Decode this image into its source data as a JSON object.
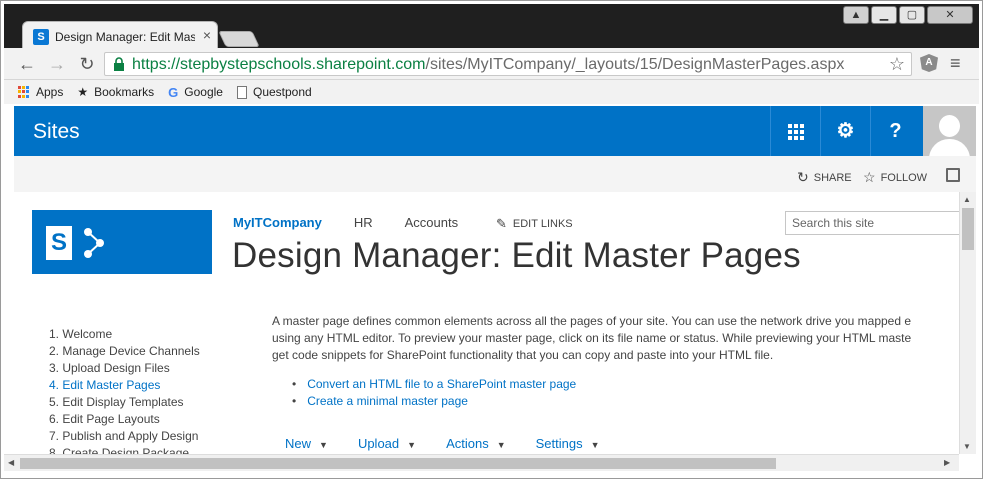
{
  "browser": {
    "tab_title": "Design Manager: Edit Mas",
    "tab_close": "×",
    "url_secure": "https://stepbystepschools.sharepoint.com",
    "url_path": "/sites/MyITCompany/_layouts/15/DesignMasterPages.aspx",
    "bookmarks": [
      {
        "label": "Apps",
        "icon": "apps-grid-icon"
      },
      {
        "label": "Bookmarks",
        "icon": "star-icon"
      },
      {
        "label": "Google",
        "icon": "google-icon"
      },
      {
        "label": "Questpond",
        "icon": "page-icon"
      }
    ]
  },
  "suite": {
    "title": "Sites",
    "settings_glyph": "⚙",
    "help_glyph": "?"
  },
  "actions": {
    "share": "SHARE",
    "follow": "FOLLOW"
  },
  "topnav": {
    "items": [
      "MyITCompany",
      "HR",
      "Accounts"
    ],
    "edit_links": "EDIT LINKS"
  },
  "search": {
    "placeholder": "Search this site"
  },
  "page": {
    "title": "Design Manager: Edit Master Pages",
    "description": [
      "A master page defines common elements across all the pages of your site. You can use the network drive you mapped e",
      "using any HTML editor. To preview your master page, click on its file name or status. While previewing your HTML maste",
      "get code snippets for SharePoint functionality that you can copy and paste into your HTML file."
    ],
    "links": [
      "Convert an HTML file to a SharePoint master page",
      "Create a minimal master page"
    ]
  },
  "quicklaunch": [
    "1. Welcome",
    "2. Manage Device Channels",
    "3. Upload Design Files",
    "4. Edit Master Pages",
    "5. Edit Display Templates",
    "6. Edit Page Layouts",
    "7. Publish and Apply Design",
    "8. Create Design Package"
  ],
  "commands": [
    "New",
    "Upload",
    "Actions",
    "Settings"
  ],
  "colors": {
    "suite_blue": "#0072c6",
    "secure_green": "#0b8043"
  }
}
